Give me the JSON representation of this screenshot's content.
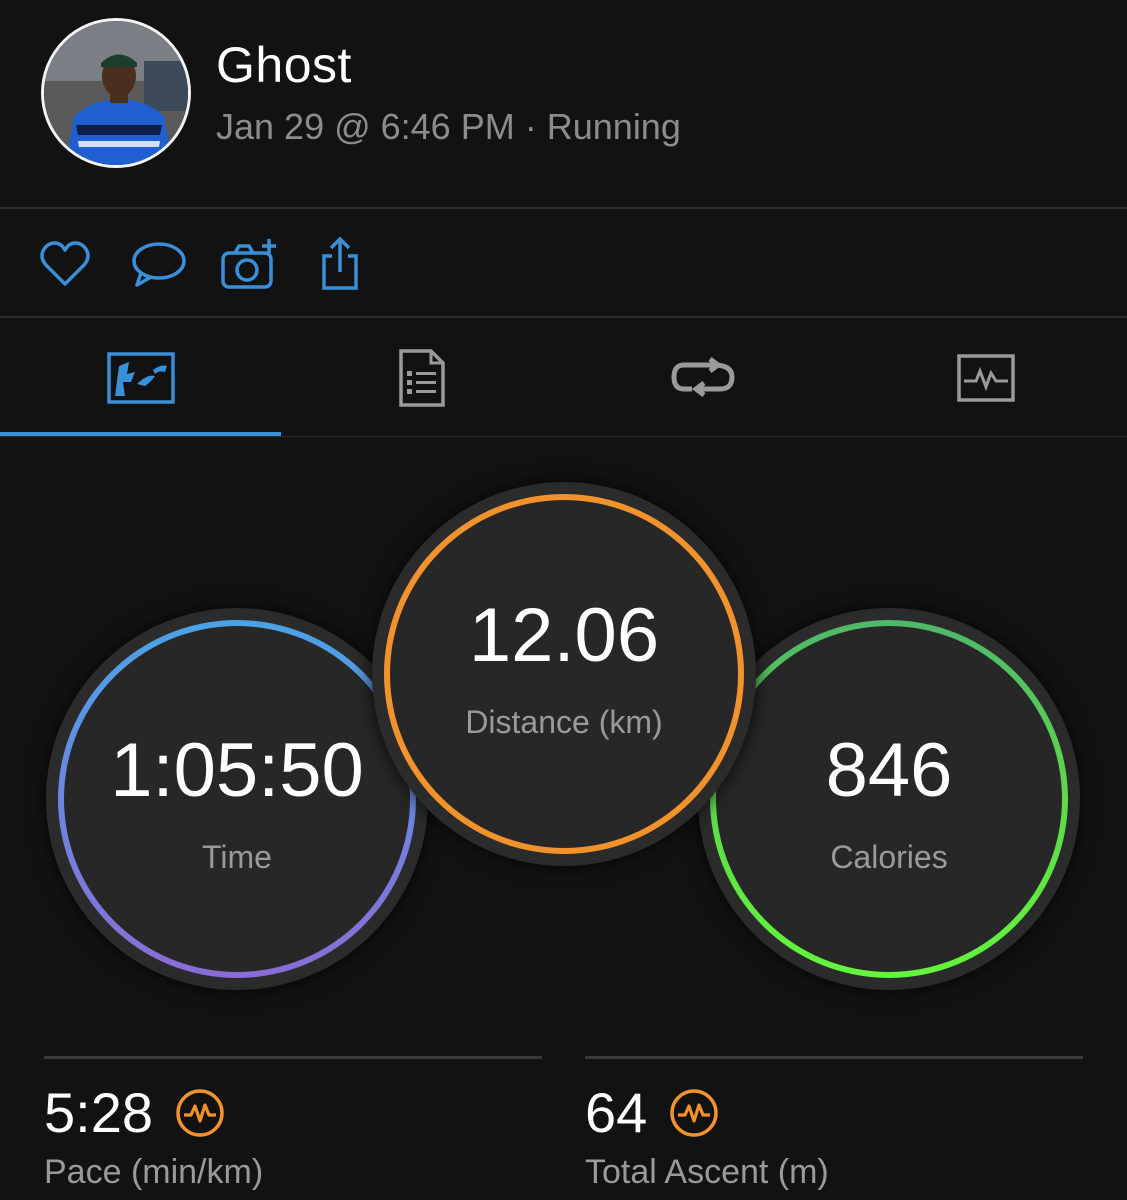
{
  "header": {
    "user_name": "Ghost",
    "date_time": "Jan 29 @ 6:46 PM",
    "separator": "·",
    "activity_type": "Running"
  },
  "actions": [
    {
      "icon": "heart-icon"
    },
    {
      "icon": "comment-icon"
    },
    {
      "icon": "camera-add-icon"
    },
    {
      "icon": "share-icon"
    }
  ],
  "tabs": [
    {
      "icon": "map-icon",
      "active": true
    },
    {
      "icon": "details-list-icon",
      "active": false
    },
    {
      "icon": "laps-loop-icon",
      "active": false
    },
    {
      "icon": "graph-chart-icon",
      "active": false
    }
  ],
  "stats": {
    "time": {
      "value": "1:05:50",
      "label": "Time"
    },
    "distance": {
      "value": "12.06",
      "label": "Distance (km)"
    },
    "calories": {
      "value": "846",
      "label": "Calories"
    }
  },
  "bottom_stats": [
    {
      "value": "5:28",
      "label": "Pace (min/km)",
      "icon": "activity-pulse-icon"
    },
    {
      "value": "64",
      "label": "Total Ascent (m)",
      "icon": "activity-pulse-icon"
    }
  ],
  "colors": {
    "accent_blue": "#3a8fd9",
    "orange": "#f2922c",
    "green_light": "#5fce6b",
    "green_bright": "#63f53c",
    "blue_ring": "#4a9be0",
    "purple_ring": "#8a6cd6",
    "icon_grey": "#9a9a9a"
  }
}
